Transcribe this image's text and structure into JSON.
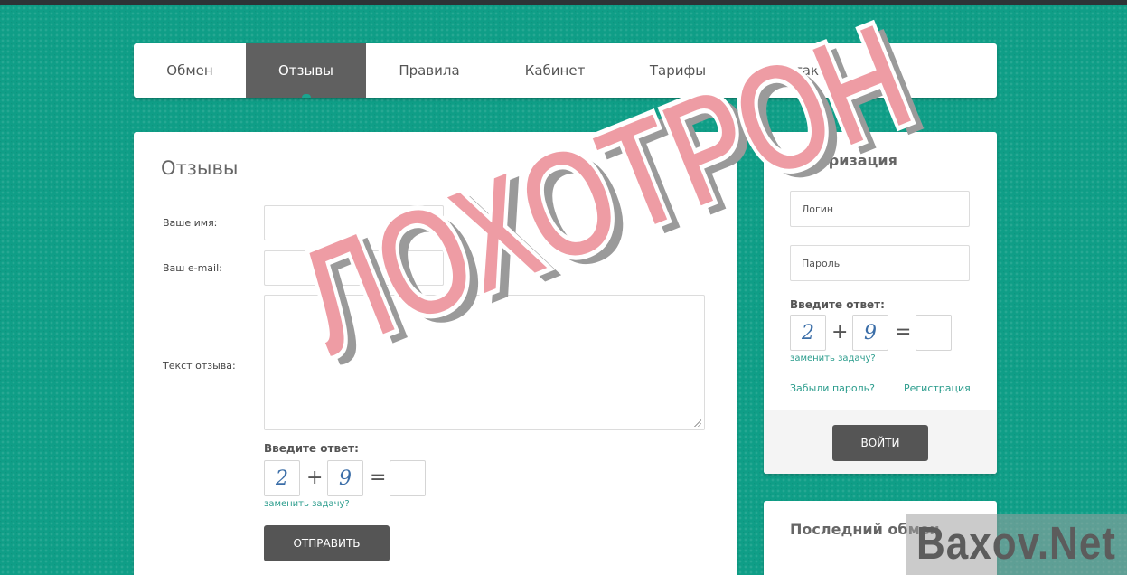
{
  "nav": {
    "items": [
      {
        "label": "Обмен"
      },
      {
        "label": "Отзывы"
      },
      {
        "label": "Правила"
      },
      {
        "label": "Кабинет"
      },
      {
        "label": "Тарифы"
      },
      {
        "label": "Контакты"
      }
    ]
  },
  "reviews": {
    "title": "Отзывы",
    "name_label": "Ваше имя:",
    "email_label": "Ваш e-mail:",
    "text_label": "Текст отзыва:",
    "captcha_label": "Введите ответ:",
    "captcha_a": "2",
    "captcha_op": "+",
    "captcha_b": "9",
    "captcha_eq": "=",
    "change_task": "заменить задачу?",
    "submit": "ОТПРАВИТЬ"
  },
  "auth": {
    "title": "Авторизация",
    "login_placeholder": "Логин",
    "password_placeholder": "Пароль",
    "captcha_label": "Введите ответ:",
    "captcha_a": "2",
    "captcha_op": "+",
    "captcha_b": "9",
    "captcha_eq": "=",
    "change_task": "заменить задачу?",
    "forgot": "Забыли пароль?",
    "register": "Регистрация",
    "submit": "ВОЙТИ"
  },
  "last_exchange": {
    "title": "Последний обмен"
  },
  "overlay": {
    "stamp": "ЛОХОТРОН",
    "watermark": "Baxov.Net"
  },
  "colors": {
    "background": "#0f9e87",
    "active_tab": "#606060",
    "stamp": "#ee9ca4"
  }
}
